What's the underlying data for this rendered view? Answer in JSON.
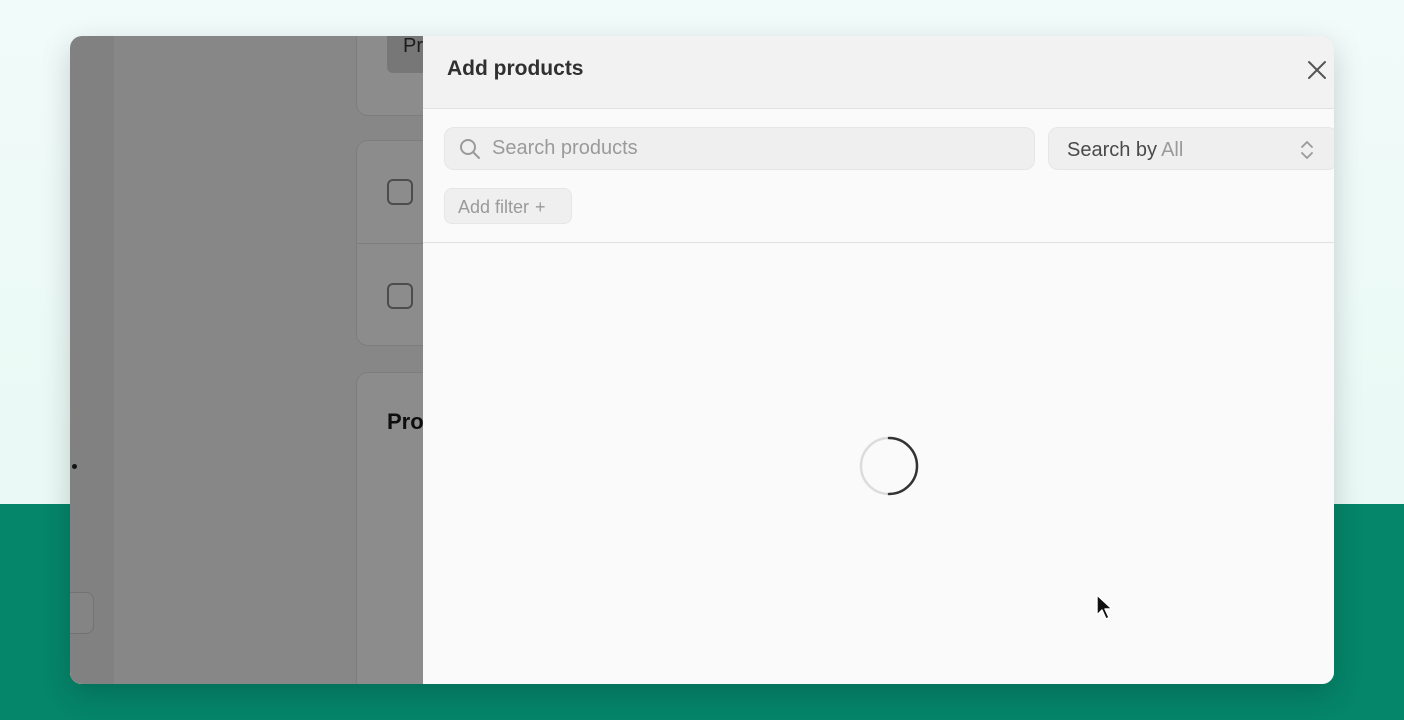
{
  "background_page": {
    "top_chip_text": "Pr",
    "section_heading": "Pro"
  },
  "modal": {
    "title": "Add products",
    "close_icon": "close-icon",
    "search": {
      "placeholder": "Search products",
      "value": "",
      "icon": "search-icon"
    },
    "search_by": {
      "label": "Search by",
      "selected": "All",
      "icon": "chevron-updown-icon"
    },
    "add_filter": {
      "label": "Add filter",
      "icon_glyph": "+"
    },
    "loading": {
      "icon": "loading-spinner-icon"
    }
  },
  "colors": {
    "brand_green": "#05856a",
    "overlay": "rgba(0,0,0,0.45)",
    "modal_header": "#f2f2f2",
    "input_bg": "#efefef"
  }
}
